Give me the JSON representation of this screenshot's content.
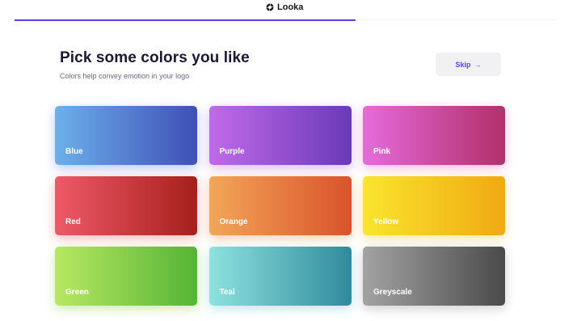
{
  "header": {
    "brand": "Looka",
    "progress_fraction": 0.63
  },
  "page": {
    "title": "Pick some colors you like",
    "subtitle": "Colors help convey emotion in your logo",
    "skip_label": "Skip",
    "skip_icon": "arrow-right-icon"
  },
  "colors": [
    {
      "label": "Blue",
      "from": "#6cb0ea",
      "to": "#3f50b5",
      "glow": "#b7c9f2"
    },
    {
      "label": "Purple",
      "from": "#c06ae8",
      "to": "#6a3ab8",
      "glow": "#d8bdf0"
    },
    {
      "label": "Pink",
      "from": "#e56bdb",
      "to": "#b2306a",
      "glow": "#f2bfe2"
    },
    {
      "label": "Red",
      "from": "#ee5a68",
      "to": "#a61f1b",
      "glow": "#f4b8bb"
    },
    {
      "label": "Orange",
      "from": "#f3a658",
      "to": "#d9532b",
      "glow": "#f6cdb0"
    },
    {
      "label": "Yellow",
      "from": "#f9e52e",
      "to": "#f0a911",
      "glow": "#f8e4a6"
    },
    {
      "label": "Green",
      "from": "#b8e862",
      "to": "#55b435",
      "glow": "#cfeab0"
    },
    {
      "label": "Teal",
      "from": "#8ee2df",
      "to": "#2f8b9b",
      "glow": "#bfe8ea"
    },
    {
      "label": "Greyscale",
      "from": "#a3a3a3",
      "to": "#4a4a4a",
      "glow": "#d0d0d0"
    }
  ]
}
